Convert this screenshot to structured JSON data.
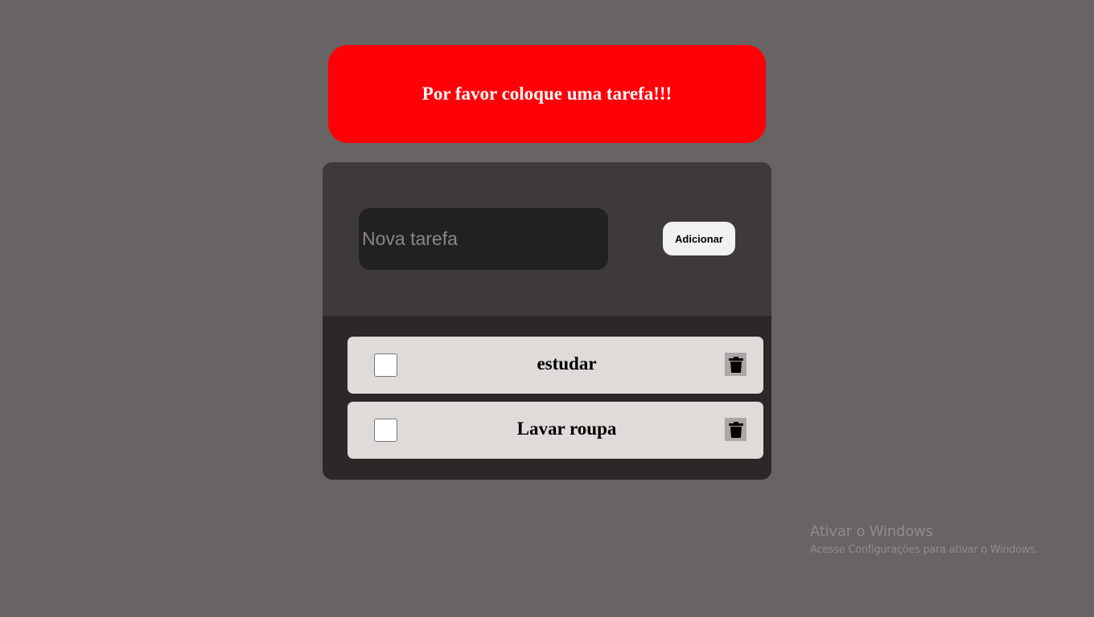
{
  "alert": {
    "message": "Por favor coloque uma tarefa!!!"
  },
  "form": {
    "input": {
      "placeholder": "Nova tarefa",
      "value": ""
    },
    "add_button_label": "Adicionar"
  },
  "tasks": [
    {
      "label": "estudar",
      "checked": false,
      "delete_icon": "trash-icon"
    },
    {
      "label": "Lavar roupa",
      "checked": false,
      "delete_icon": "trash-icon"
    }
  ],
  "watermark": {
    "title": "Ativar o Windows",
    "subtitle": "Acesse Configurações para ativar o Windows."
  },
  "colors": {
    "page_background": "#676463",
    "alert_background": "#ff0008",
    "form_background": "#3e3a39",
    "list_background": "#2d2828",
    "input_background": "#222121",
    "task_item_background": "#dedbd8",
    "delete_button_background": "#aba7a4"
  }
}
